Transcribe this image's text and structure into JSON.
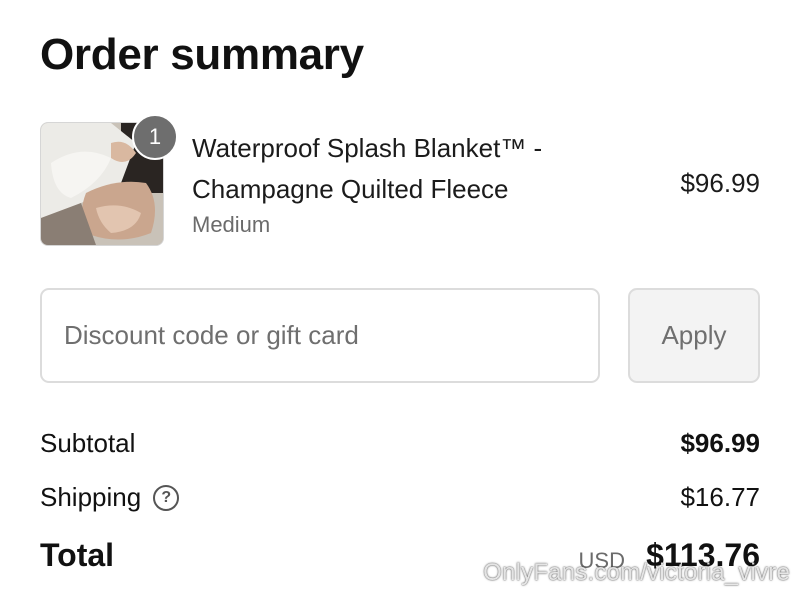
{
  "page": {
    "title": "Order summary"
  },
  "product": {
    "quantity": "1",
    "name": "Waterproof Splash Blanket™ - Champagne Quilted Fleece",
    "variant": "Medium",
    "price": "$96.99"
  },
  "discount": {
    "placeholder": "Discount code or gift card",
    "value": "",
    "apply_label": "Apply"
  },
  "summary": {
    "subtotal_label": "Subtotal",
    "subtotal_value": "$96.99",
    "shipping_label": "Shipping",
    "shipping_icon": "question-circle-icon",
    "shipping_value": "$16.77",
    "total_label": "Total",
    "currency": "USD",
    "total_value": "$113.76"
  },
  "watermark": {
    "text": "OnlyFans.com/victoria_vivre"
  }
}
